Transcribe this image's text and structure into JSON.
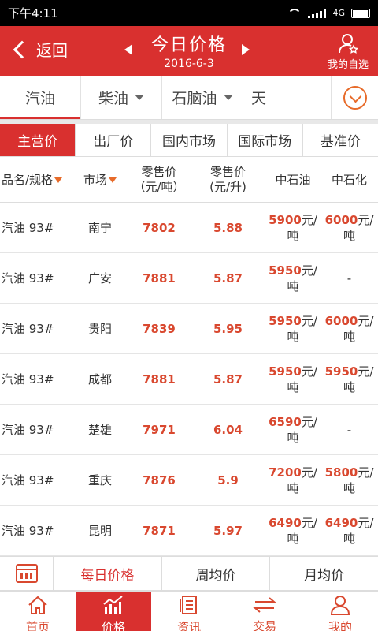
{
  "status": {
    "time": "下午4:11",
    "net": "4G"
  },
  "header": {
    "back_label": "返回",
    "title": "今日价格",
    "date": "2016-6-3",
    "favorites_label": "我的自选"
  },
  "categories": [
    {
      "label": "汽油",
      "dropdown": false
    },
    {
      "label": "柴油",
      "dropdown": true
    },
    {
      "label": "石脑油",
      "dropdown": true
    },
    {
      "label": "天",
      "dropdown": false
    }
  ],
  "sub_tabs": [
    "主营价",
    "出厂价",
    "国内市场",
    "国际市场",
    "基准价"
  ],
  "columns": {
    "name": "品名/规格",
    "market": "市场",
    "retail_ton_1": "零售价",
    "retail_ton_2": "（元/吨）",
    "retail_liter_1": "零售价",
    "retail_liter_2": "(元/升)",
    "cnpc": "中石油",
    "sinopec": "中石化"
  },
  "rows": [
    {
      "name": "汽油 93#",
      "market": "南宁",
      "ton": "7802",
      "liter": "5.88",
      "cnpc_num": "5900",
      "cnpc_unit1": "元/",
      "cnpc_unit2": "吨",
      "sinopec_num": "6000",
      "sinopec_unit1": "元/",
      "sinopec_unit2": "吨"
    },
    {
      "name": "汽油 93#",
      "market": "广安",
      "ton": "7881",
      "liter": "5.87",
      "cnpc_num": "5950",
      "cnpc_unit1": "元/",
      "cnpc_unit2": "吨",
      "sinopec_num": "",
      "sinopec_unit1": "-",
      "sinopec_unit2": ""
    },
    {
      "name": "汽油 93#",
      "market": "贵阳",
      "ton": "7839",
      "liter": "5.95",
      "cnpc_num": "5950",
      "cnpc_unit1": "元/",
      "cnpc_unit2": "吨",
      "sinopec_num": "6000",
      "sinopec_unit1": "元/",
      "sinopec_unit2": "吨"
    },
    {
      "name": "汽油 93#",
      "market": "成都",
      "ton": "7881",
      "liter": "5.87",
      "cnpc_num": "5950",
      "cnpc_unit1": "元/",
      "cnpc_unit2": "吨",
      "sinopec_num": "5950",
      "sinopec_unit1": "元/",
      "sinopec_unit2": "吨"
    },
    {
      "name": "汽油 93#",
      "market": "楚雄",
      "ton": "7971",
      "liter": "6.04",
      "cnpc_num": "6590",
      "cnpc_unit1": "元/",
      "cnpc_unit2": "吨",
      "sinopec_num": "",
      "sinopec_unit1": "-",
      "sinopec_unit2": ""
    },
    {
      "name": "汽油 93#",
      "market": "重庆",
      "ton": "7876",
      "liter": "5.9",
      "cnpc_num": "7200",
      "cnpc_unit1": "元/",
      "cnpc_unit2": "吨",
      "sinopec_num": "5800",
      "sinopec_unit1": "元/",
      "sinopec_unit2": "吨"
    },
    {
      "name": "汽油 93#",
      "market": "昆明",
      "ton": "7871",
      "liter": "5.97",
      "cnpc_num": "6490",
      "cnpc_unit1": "元/",
      "cnpc_unit2": "吨",
      "sinopec_num": "6490",
      "sinopec_unit1": "元/",
      "sinopec_unit2": "吨"
    }
  ],
  "period_tabs": [
    "每日价格",
    "周均价",
    "月均价"
  ],
  "bottom_nav": [
    "首页",
    "价格",
    "资讯",
    "交易",
    "我的"
  ],
  "colors": {
    "brand": "#d9302f",
    "accent": "#e76b2a"
  }
}
